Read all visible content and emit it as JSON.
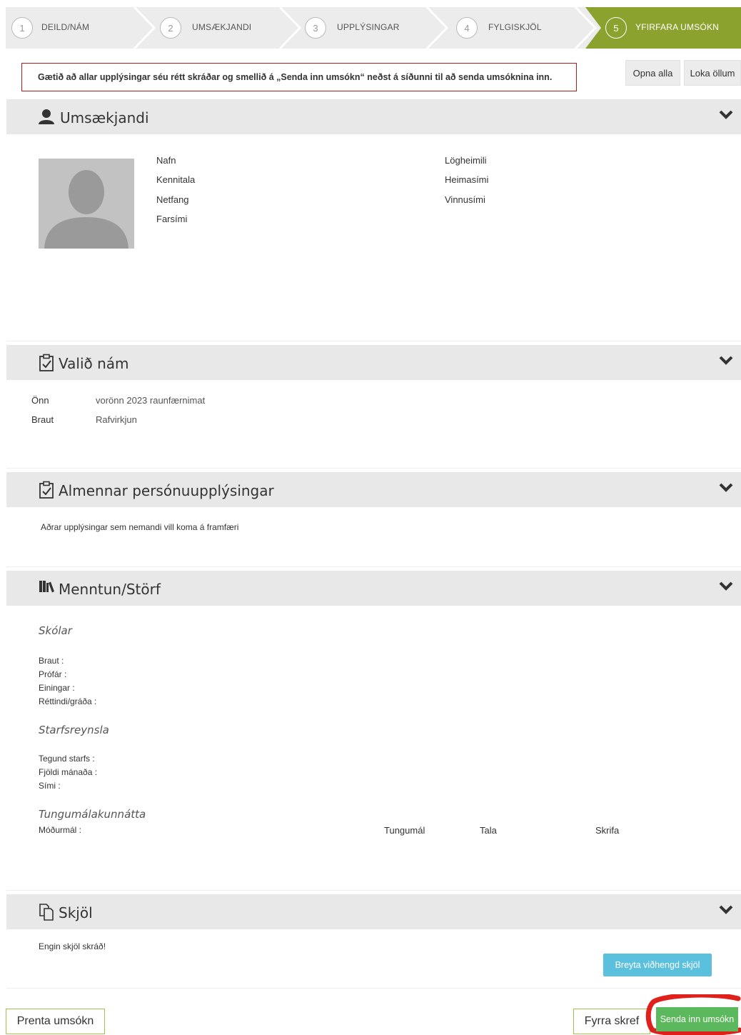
{
  "stepper": {
    "steps": [
      {
        "num": "1",
        "label": "DEILD/NÁM"
      },
      {
        "num": "2",
        "label": "UMSÆKJANDI"
      },
      {
        "num": "3",
        "label": "UPPLÝSINGAR"
      },
      {
        "num": "4",
        "label": "FYLGISKJÖL"
      },
      {
        "num": "5",
        "label": "YFIRFARA UMSÓKN"
      }
    ],
    "active_color": "#8ba22f"
  },
  "alert": {
    "text": "Gætið að allar upplýsingar séu rétt skráðar og smellið á „Senda inn umsókn“ neðst á síðunni til að senda umsóknina inn."
  },
  "controls": {
    "open_all": "Opna alla",
    "close_all": "Loka öllum"
  },
  "applicant": {
    "title": "Umsækjandi",
    "icon": "user-icon",
    "fields_left": [
      "Nafn",
      "Kennitala",
      "Netfang",
      "Farsími"
    ],
    "fields_right": [
      "Lögheimili",
      "Heimasími",
      "Vinnusími"
    ]
  },
  "chosen": {
    "title": "Valið nám",
    "icon": "clipboard-check-icon",
    "rows": [
      {
        "label": "Önn",
        "value": "vorönn 2023 raunfærnimat"
      },
      {
        "label": "Braut",
        "value": "Rafvirkjun"
      }
    ]
  },
  "general": {
    "title": "Almennar persónuupplýsingar",
    "icon": "clipboard-check-icon",
    "text": "Aðrar upplýsingar sem nemandi vill koma á framfæri"
  },
  "education": {
    "title": "Menntun/Störf",
    "icon": "books-icon",
    "schools_heading": "Skólar",
    "schools_fields": [
      "Braut :",
      "Prófár :",
      "Einingar :",
      "Réttindi/gráða :"
    ],
    "work_heading": "Starfsreynsla",
    "work_fields": [
      "Tegund starfs :",
      "Fjöldi mánaða :",
      "Sími :"
    ],
    "language_heading": "Tungumálakunnátta",
    "mother_tongue": "Móðurmál :",
    "language_columns": [
      "Tungumál",
      "Tala",
      "Skrifa"
    ]
  },
  "documents": {
    "title": "Skjöl",
    "icon": "copy-icon",
    "empty_text": "Engin skjöl skráð!",
    "edit_button": "Breyta viðhengd skjöl"
  },
  "footer": {
    "print": "Prenta umsókn",
    "previous": "Fyrra skref",
    "submit": "Senda inn umsókn",
    "highlight_color": "#e0201a"
  }
}
